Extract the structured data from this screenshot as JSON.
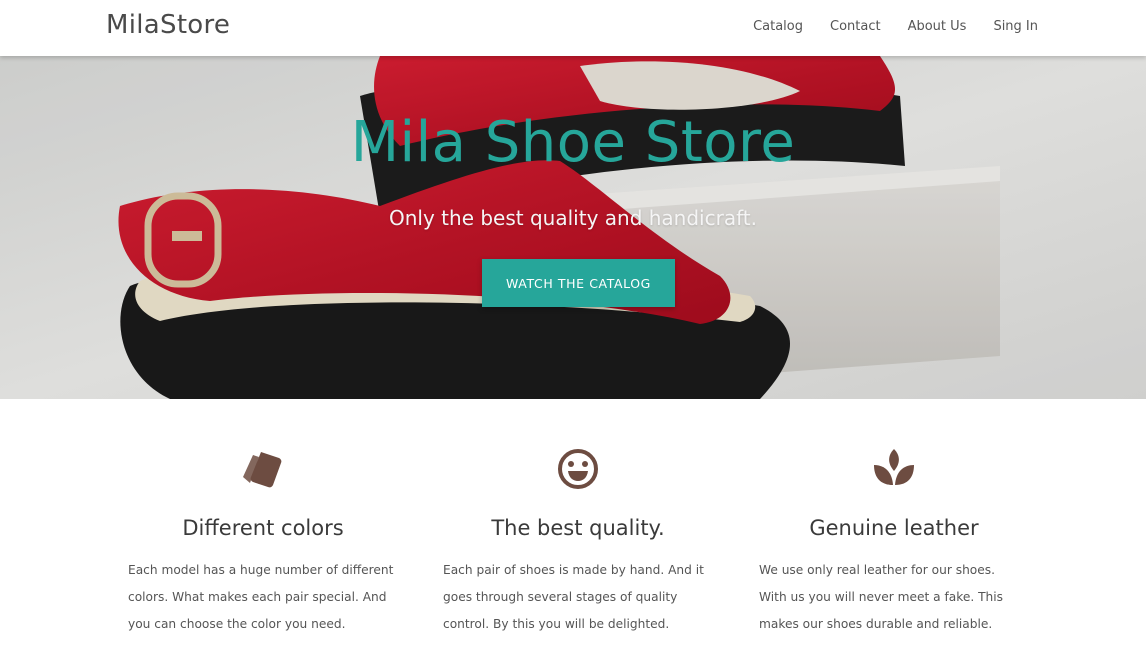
{
  "navbar": {
    "brand": "MilaStore",
    "links": [
      "Catalog",
      "Contact",
      "About Us",
      "Sing In"
    ]
  },
  "hero": {
    "title": "Mila Shoe Store",
    "subtitle": "Only the best quality and handicraft.",
    "button_label": "WATCH THE CATALOG"
  },
  "features": [
    {
      "icon": "tags-icon",
      "title": "Different colors",
      "text": "Each model has a huge number of different colors. What makes each pair special. And you can choose the color you need."
    },
    {
      "icon": "smile-icon",
      "title": "The best quality.",
      "text": "Each pair of shoes is made by hand. And it goes through several stages of quality control. By this you will be delighted."
    },
    {
      "icon": "leaf-icon",
      "title": "Genuine leather",
      "text": "We use only real leather for our shoes. With us you will never meet a fake. This makes our shoes durable and reliable."
    }
  ],
  "colors": {
    "accent": "#26a69a",
    "icon_brown": "#6d4c41",
    "shoe_red": "#c8102e"
  }
}
